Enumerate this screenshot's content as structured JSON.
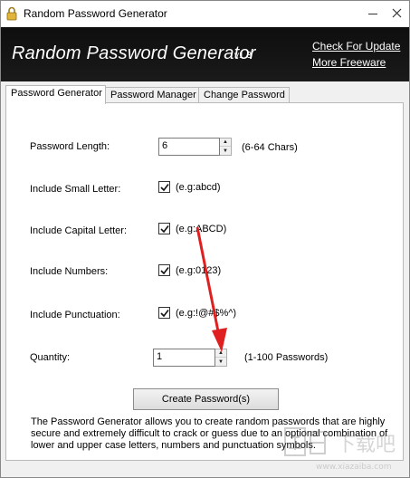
{
  "window": {
    "title": "Random Password Generator",
    "icon": "padlock-icon"
  },
  "banner": {
    "title": "Random Password Generator",
    "version": "v1.3",
    "link_update": "Check For Update",
    "link_freeware": "More Freeware"
  },
  "tabs": [
    {
      "label": "Password Generator",
      "active": true
    },
    {
      "label": "Password Manager",
      "active": false
    },
    {
      "label": "Change Password",
      "active": false
    }
  ],
  "form": {
    "length_label": "Password Length:",
    "length_value": "6",
    "length_hint": "(6-64 Chars)",
    "small_label": "Include Small Letter:",
    "small_checked": true,
    "small_hint": "(e.g:abcd)",
    "capital_label": "Include Capital Letter:",
    "capital_checked": true,
    "capital_hint": "(e.g:ABCD)",
    "numbers_label": "Include Numbers:",
    "numbers_checked": true,
    "numbers_hint": "(e.g:0123)",
    "punct_label": "Include Punctuation:",
    "punct_checked": true,
    "punct_hint": "(e.g:!@#$%^)",
    "quantity_label": "Quantity:",
    "quantity_value": "1",
    "quantity_hint": "(1-100 Passwords)"
  },
  "create_button": "Create Password(s)",
  "description": "The Password Generator allows you to create random passwords that are highly secure and extremely difficult to crack or guess due to an optional combination of lower and upper case letters, numbers and punctuation symbols.",
  "watermark": {
    "text": "下载吧",
    "url": "www.xiazaiba.com"
  },
  "colors": {
    "banner_bg": "#111111",
    "annotation_arrow": "#e02020"
  }
}
